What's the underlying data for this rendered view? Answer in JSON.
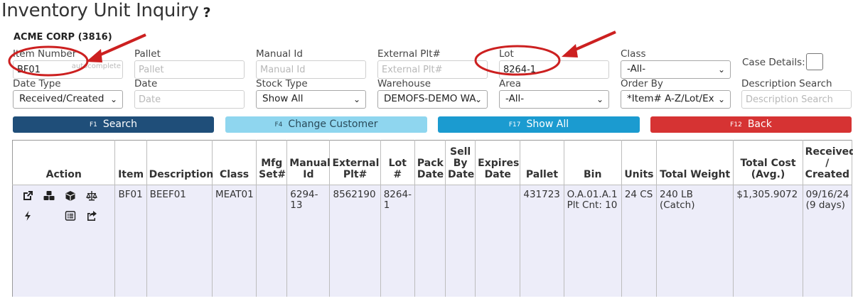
{
  "page": {
    "title": "Inventory Unit Inquiry",
    "help_icon": "?"
  },
  "customer": "ACME CORP (3816)",
  "filters": {
    "item_number": {
      "label": "Item Number",
      "value": "BF01",
      "hint": "autocomplete"
    },
    "pallet": {
      "label": "Pallet",
      "placeholder": "Pallet"
    },
    "manual_id": {
      "label": "Manual Id",
      "placeholder": "Manual Id"
    },
    "external_plt": {
      "label": "External Plt#",
      "placeholder": "External Plt#"
    },
    "lot": {
      "label": "Lot",
      "value": "8264-1"
    },
    "class": {
      "label": "Class",
      "value": "-All-"
    },
    "case_details": {
      "label": "Case Details:"
    },
    "date_type": {
      "label": "Date Type",
      "value": "Received/Created"
    },
    "date": {
      "label": "Date",
      "placeholder": "Date"
    },
    "stock_type": {
      "label": "Stock Type",
      "value": "Show All"
    },
    "warehouse": {
      "label": "Warehouse",
      "value": "DEMOFS-DEMO WA"
    },
    "area": {
      "label": "Area",
      "value": "-All-"
    },
    "order_by": {
      "label": "Order By",
      "value": "*Item# A-Z/Lot/Ex"
    },
    "description_search": {
      "label": "Description Search",
      "placeholder": "Description Search"
    }
  },
  "buttons": {
    "search": {
      "fkey": "F1",
      "label": "Search"
    },
    "change_customer": {
      "fkey": "F4",
      "label": "Change Customer"
    },
    "show_all": {
      "fkey": "F17",
      "label": "Show All"
    },
    "back": {
      "fkey": "F12",
      "label": "Back"
    }
  },
  "table": {
    "headers": {
      "action": "Action",
      "item": "Item",
      "description": "Description",
      "class": "Class",
      "mfg_set": "Mfg Set#",
      "manual_id": "Manual Id",
      "external_plt": "External Plt#",
      "lot": "Lot #",
      "pack_date": "Pack Date",
      "sell_by_date": "Sell By Date",
      "expires_date": "Expires Date",
      "pallet": "Pallet",
      "bin": "Bin",
      "units": "Units",
      "total_weight": "Total Weight",
      "total_cost": "Total Cost (Avg.)",
      "received": "Received / Created"
    },
    "rows": [
      {
        "action_icons": [
          "external-link-icon",
          "boxes-icon",
          "cube-icon",
          "scale-icon",
          "bolt-icon",
          "list-icon",
          "share-icon"
        ],
        "item": "BF01",
        "description": "BEEF01",
        "class": "MEAT01",
        "mfg_set": "",
        "manual_id": "6294-13",
        "external_plt": "8562190",
        "lot": "8264-1",
        "pack_date": "",
        "sell_by_date": "",
        "expires_date": "",
        "pallet": "431723",
        "bin": "O.A.01.A.1",
        "bin_count": "Plt Cnt: 10",
        "units": "24 CS",
        "total_weight": "240 LB (Catch)",
        "total_cost": "$1,305.9072",
        "received": "09/16/24",
        "received_age": "(9 days)"
      }
    ]
  },
  "colors": {
    "annotation": "#cc2020",
    "row_bg": "#ededf9"
  }
}
